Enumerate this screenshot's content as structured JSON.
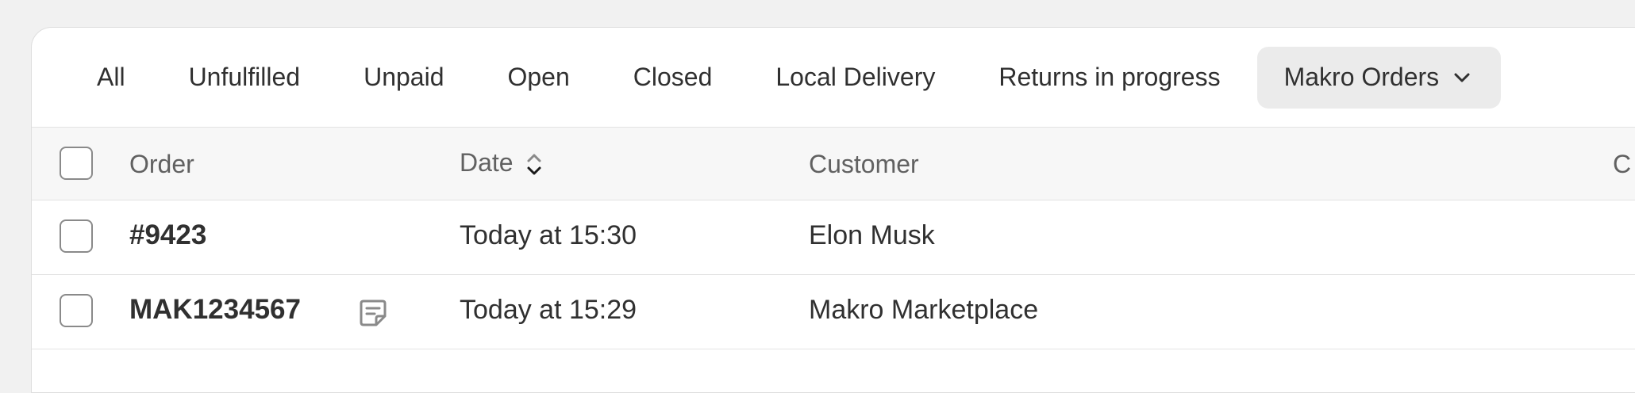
{
  "tabs": [
    {
      "label": "All"
    },
    {
      "label": "Unfulfilled"
    },
    {
      "label": "Unpaid"
    },
    {
      "label": "Open"
    },
    {
      "label": "Closed"
    },
    {
      "label": "Local Delivery"
    },
    {
      "label": "Returns in progress"
    },
    {
      "label": "Makro Orders",
      "active": true,
      "icon": "chevron-down-icon"
    }
  ],
  "table": {
    "headers": {
      "order": "Order",
      "date": "Date",
      "customer": "Customer",
      "truncated": "C"
    },
    "rows": [
      {
        "order": "#9423",
        "date": "Today at 15:30",
        "customer": "Elon Musk",
        "has_note": false
      },
      {
        "order": "MAK1234567",
        "date": "Today at 15:29",
        "customer": "Makro Marketplace",
        "has_note": true,
        "note_icon": "note-icon"
      }
    ]
  },
  "colors": {
    "page_bg": "#f1f1f1",
    "card_bg": "#ffffff",
    "header_bg": "#f7f7f7",
    "active_tab_bg": "#ebebeb",
    "text": "#303030",
    "muted_text": "#616161"
  }
}
